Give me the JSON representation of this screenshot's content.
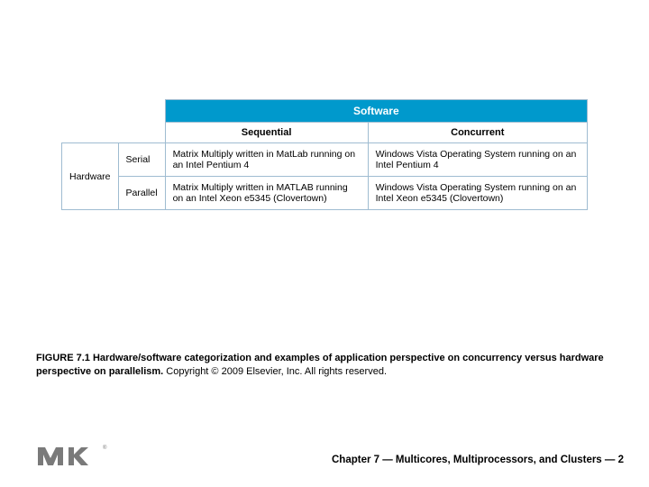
{
  "table": {
    "software_header": "Software",
    "col_sequential": "Sequential",
    "col_concurrent": "Concurrent",
    "hardware_label": "Hardware",
    "row_serial": "Serial",
    "row_parallel": "Parallel",
    "cell_serial_sequential": "Matrix Multiply written in MatLab running on an Intel Pentium 4",
    "cell_serial_concurrent": "Windows Vista Operating System running on an Intel Pentium 4",
    "cell_parallel_sequential": "Matrix Multiply written in MATLAB running on an Intel Xeon e5345 (Clovertown)",
    "cell_parallel_concurrent": "Windows Vista Operating System running on an Intel Xeon e5345 (Clovertown)"
  },
  "caption": {
    "bold": "FIGURE 7.1 Hardware/software categorization and examples of application perspective on concurrency versus hardware perspective on parallelism.",
    "rest": " Copyright © 2009 Elsevier, Inc. All rights reserved."
  },
  "footer": {
    "text": "Chapter 7 — Multicores, Multiprocessors, and Clusters — 2"
  }
}
